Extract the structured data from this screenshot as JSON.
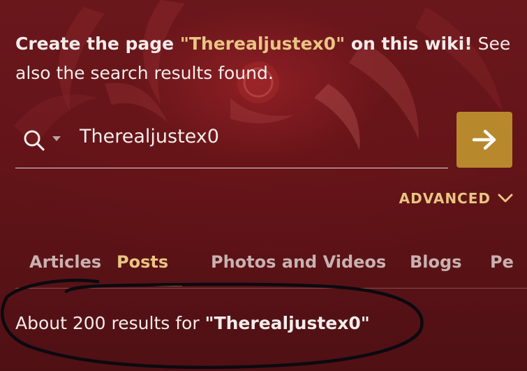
{
  "create_notice": {
    "prefix": "Create the page ",
    "page_name": "\"Therealjustex0\"",
    "middle": " on this wiki!",
    "suffix": " See also the search results found."
  },
  "search": {
    "value": "Therealjustex0",
    "search_icon": "search-icon",
    "go_icon": "arrow-right-icon"
  },
  "advanced": {
    "label": "ADVANCED",
    "icon": "chevron-down-icon"
  },
  "tabs": [
    {
      "label": "Articles",
      "active": false
    },
    {
      "label": "Posts",
      "active": true
    },
    {
      "label": "Photos and Videos",
      "active": false
    },
    {
      "label": "Blogs",
      "active": false
    },
    {
      "label": "Pe",
      "active": false
    }
  ],
  "results": {
    "prefix": "About 200 results for ",
    "query": "\"Therealjustex0\""
  },
  "colors": {
    "background": "#5a1418",
    "accent": "#e8c583",
    "button": "#b8882c",
    "text": "#f3ecea"
  }
}
